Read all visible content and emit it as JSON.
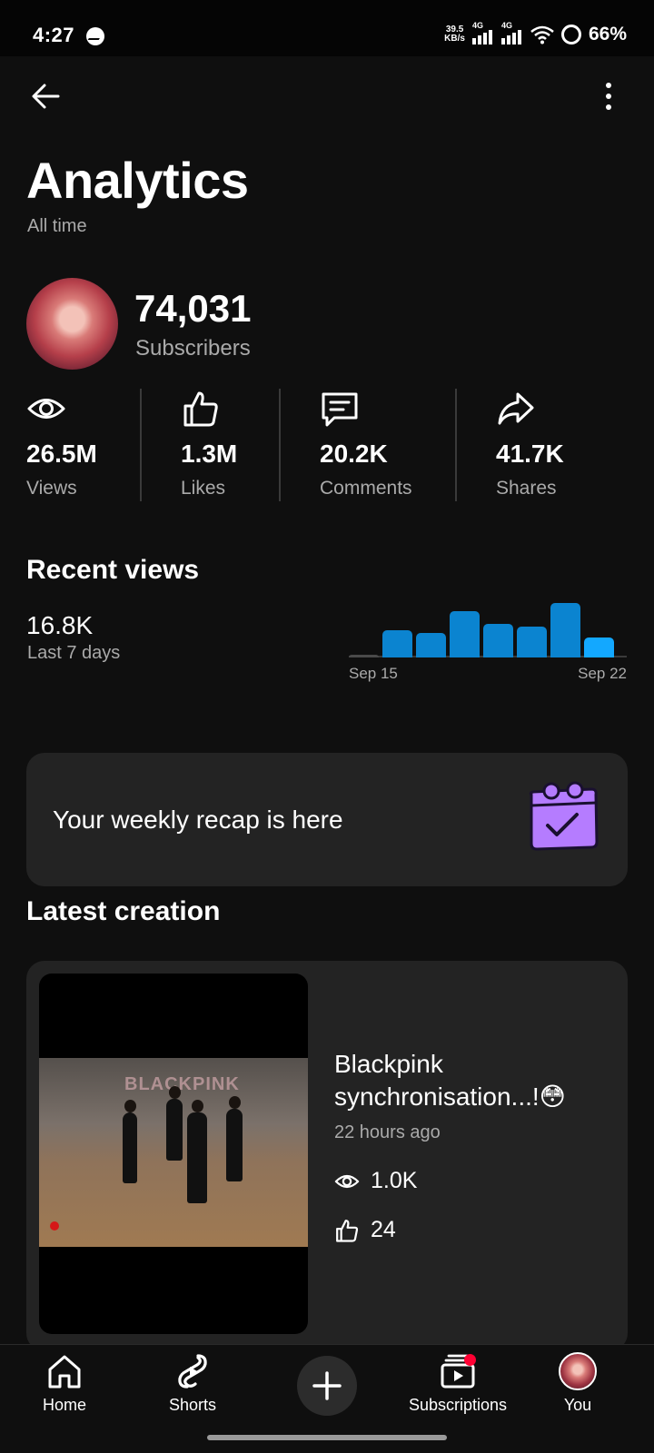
{
  "status_bar": {
    "time": "4:27",
    "speed_value": "39.5",
    "speed_unit": "KB/s",
    "network_1": "4G",
    "network_2": "4G",
    "battery": "66%"
  },
  "header": {
    "title": "Analytics",
    "range": "All time"
  },
  "channel": {
    "subscriber_count": "74,031",
    "subscriber_label": "Subscribers"
  },
  "stats": [
    {
      "icon": "eye-icon",
      "value": "26.5M",
      "label": "Views"
    },
    {
      "icon": "thumbs-up-icon",
      "value": "1.3M",
      "label": "Likes"
    },
    {
      "icon": "comment-icon",
      "value": "20.2K",
      "label": "Comments"
    },
    {
      "icon": "share-icon",
      "value": "41.7K",
      "label": "Shares"
    }
  ],
  "recent_views": {
    "title": "Recent views",
    "value": "16.8K",
    "label": "Last 7 days",
    "x_start": "Sep 15",
    "x_end": "Sep 22"
  },
  "chart_data": {
    "type": "bar",
    "title": "",
    "x_tick_labels": [
      "Sep 15",
      "Sep 22"
    ],
    "values": [
      0.05,
      0.5,
      0.45,
      0.85,
      0.62,
      0.57,
      1.0,
      0.37
    ],
    "value_scale": "relative (fraction of tallest bar, no y-axis shown)",
    "colors": {
      "bar": "#0b84d0",
      "latest_bar": "#13a8ff",
      "first_bar": "#4a4a4a"
    }
  },
  "recap": {
    "text": "Your weekly recap is here",
    "icon": "calendar-check-icon",
    "icon_color": "#b57cff"
  },
  "latest": {
    "title": "Latest creation",
    "video": {
      "thumbnail_text": "BLACKPINK",
      "title": "Blackpink synchronisation...!😳",
      "age": "22 hours ago",
      "views": "1.0K",
      "likes": "24"
    }
  },
  "nav": {
    "home": "Home",
    "shorts": "Shorts",
    "subscriptions": "Subscriptions",
    "you": "You"
  },
  "colors": {
    "background": "#0f0f0f",
    "card": "#232323",
    "secondary_text": "#aaaaaa",
    "notification": "#ff0033"
  }
}
